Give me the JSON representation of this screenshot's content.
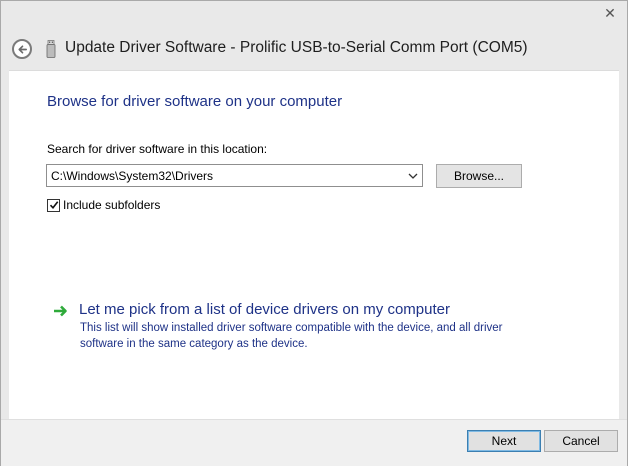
{
  "window": {
    "title": "Update Driver Software - Prolific USB-to-Serial Comm Port (COM5)",
    "close_glyph": "✕"
  },
  "content": {
    "heading": "Browse for driver software on your computer",
    "search_label": "Search for driver software in this location:",
    "path_value": "C:\\Windows\\System32\\Drivers",
    "browse_label": "Browse...",
    "include_subfolders_label": "Include subfolders",
    "include_subfolders_checked": true,
    "pick_title": "Let me pick from a list of device drivers on my computer",
    "pick_description": "This list will show installed driver software compatible with the device, and all driver software in the same category as the device."
  },
  "footer": {
    "next_label": "Next",
    "cancel_label": "Cancel"
  },
  "icons": {
    "back": "back-arrow-icon",
    "device": "usb-device-icon",
    "dropdown": "chevron-down-icon",
    "check": "checkmark-icon",
    "pick": "green-arrow-icon"
  },
  "colors": {
    "link_blue": "#1e3287",
    "window_chrome": "#e9e9e9",
    "footer_bg": "#f0f0f0",
    "green_arrow": "#2eaa3a"
  }
}
